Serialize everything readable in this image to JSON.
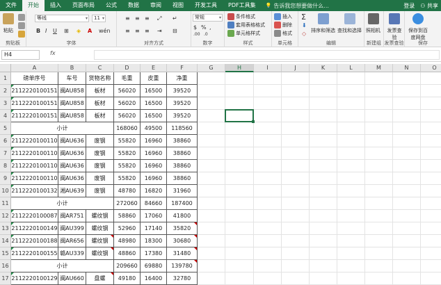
{
  "menu": {
    "tabs": [
      "文件",
      "开始",
      "插入",
      "页面布局",
      "公式",
      "数据",
      "审阅",
      "视图",
      "开发工具",
      "PDF工具集"
    ],
    "active_index": 1,
    "tell_me": "告诉我您想要做什么...",
    "login": "登录",
    "share": "共享"
  },
  "ribbon": {
    "paste": "粘贴",
    "clipboard": "剪贴板",
    "font_name": "等线",
    "font_size": "11",
    "font_group": "字体",
    "align_group": "对齐方式",
    "number_format": "常规",
    "number_group": "数字",
    "cond_format": "条件格式",
    "table_format": "套用表格格式",
    "cell_style": "单元格样式",
    "style_group": "样式",
    "insert": "插入",
    "delete": "删除",
    "format": "格式",
    "cells_group": "单元格",
    "sort_filter": "排序和筛选",
    "find_select": "查找和选择",
    "edit_group": "编辑",
    "camera": "照相机",
    "camera_group": "新建组",
    "invoice_check": "发票查验",
    "invoice_group": "发票查验",
    "save_baidu": "保存到百度网盘",
    "save_group": "保存",
    "fx": "fx"
  },
  "formula_bar": {
    "name_box": "H4",
    "formula": ""
  },
  "columns": [
    "A",
    "B",
    "C",
    "D",
    "E",
    "F",
    "G",
    "H",
    "I",
    "J",
    "K",
    "L",
    "M",
    "N",
    "O"
  ],
  "selected_column": "H",
  "selected_cell": "H4",
  "rows": [
    [
      "磅单序号",
      "车号",
      "货物名称",
      "毛重",
      "皮重",
      "净重"
    ],
    [
      "2112220100151",
      "闽AU858",
      "板材",
      "56020",
      "16500",
      "39520"
    ],
    [
      "2112220100151",
      "闽AU858",
      "板材",
      "56020",
      "16500",
      "39520"
    ],
    [
      "2112220100151",
      "闽AU858",
      "板材",
      "56020",
      "16500",
      "39520"
    ],
    [
      "小计",
      "",
      "",
      "168060",
      "49500",
      "118560"
    ],
    [
      "2112220100110",
      "闽AU636",
      "废钢",
      "55820",
      "16960",
      "38860"
    ],
    [
      "2112220100110",
      "闽AU636",
      "废钢",
      "55820",
      "16960",
      "38860"
    ],
    [
      "2112220100110",
      "闽AU636",
      "废钢",
      "55820",
      "16960",
      "38860"
    ],
    [
      "2112220100110",
      "闽AU636",
      "废钢",
      "55820",
      "16960",
      "38860"
    ],
    [
      "2112220100132",
      "湘AU639",
      "废钢",
      "48780",
      "16820",
      "31960"
    ],
    [
      "小计",
      "",
      "",
      "272060",
      "84660",
      "187400"
    ],
    [
      "2112220100087",
      "闽AR751",
      "螺纹钢",
      "58860",
      "17060",
      "41800"
    ],
    [
      "2112220100149",
      "闽AU399",
      "螺纹钢",
      "52960",
      "17140",
      "35820"
    ],
    [
      "2112220100188",
      "闽AR656",
      "螺纹钢",
      "48980",
      "18300",
      "30680"
    ],
    [
      "2112220100155",
      "赣AU339",
      "螺纹钢",
      "48860",
      "17380",
      "31480"
    ],
    [
      "小计",
      "",
      "",
      "209660",
      "69880",
      "139780"
    ],
    [
      "2112220100129",
      "闽AU660",
      "盘螺",
      "49180",
      "16400",
      "32780"
    ]
  ],
  "row_numbers": [
    "1",
    "2",
    "3",
    "4",
    "5",
    "6",
    "7",
    "8",
    "9",
    "10",
    "11",
    "12",
    "13",
    "14",
    "15",
    "16",
    "17"
  ],
  "colors": {
    "excel_green": "#217346",
    "error_triangle": "#c00000",
    "text_triangle": "#1e8a46"
  }
}
